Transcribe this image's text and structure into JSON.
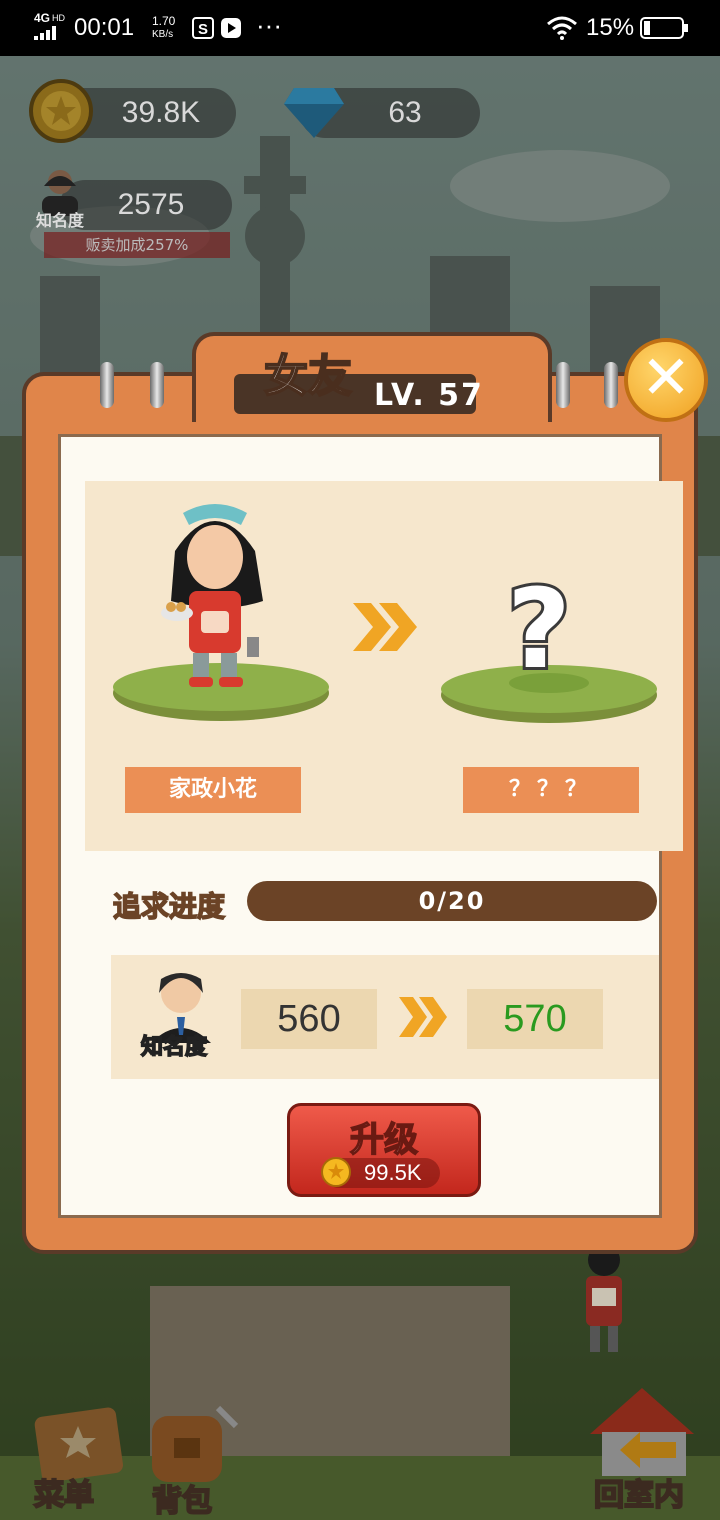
{
  "status_bar": {
    "network": "4G",
    "network_sup": "HD",
    "time": "00:01",
    "speed_value": "1.70",
    "speed_unit": "KB/s",
    "battery": "15%"
  },
  "resources": {
    "coins": "39.8K",
    "gems": "63",
    "fame_value": "2575",
    "fame_label": "知名度",
    "sales_bonus": "贩卖加成257%"
  },
  "dialog": {
    "title": "女友",
    "level": "LV. 57",
    "current_name": "家政小花",
    "next_name": "？？？",
    "progress_label": "追求进度",
    "progress_text": "0/20",
    "fame_label": "知名度",
    "fame_current": "560",
    "fame_next": "570",
    "upgrade_label": "升级",
    "upgrade_cost": "99.5K"
  },
  "bottom_nav": {
    "menu": "菜单",
    "bag": "背包",
    "home": "回室内"
  },
  "colors": {
    "panel_orange": "#e0854a",
    "paper": "#fdfaf2",
    "upgrade_red": "#d9372b",
    "fame_next_green": "#2a9a1f"
  }
}
